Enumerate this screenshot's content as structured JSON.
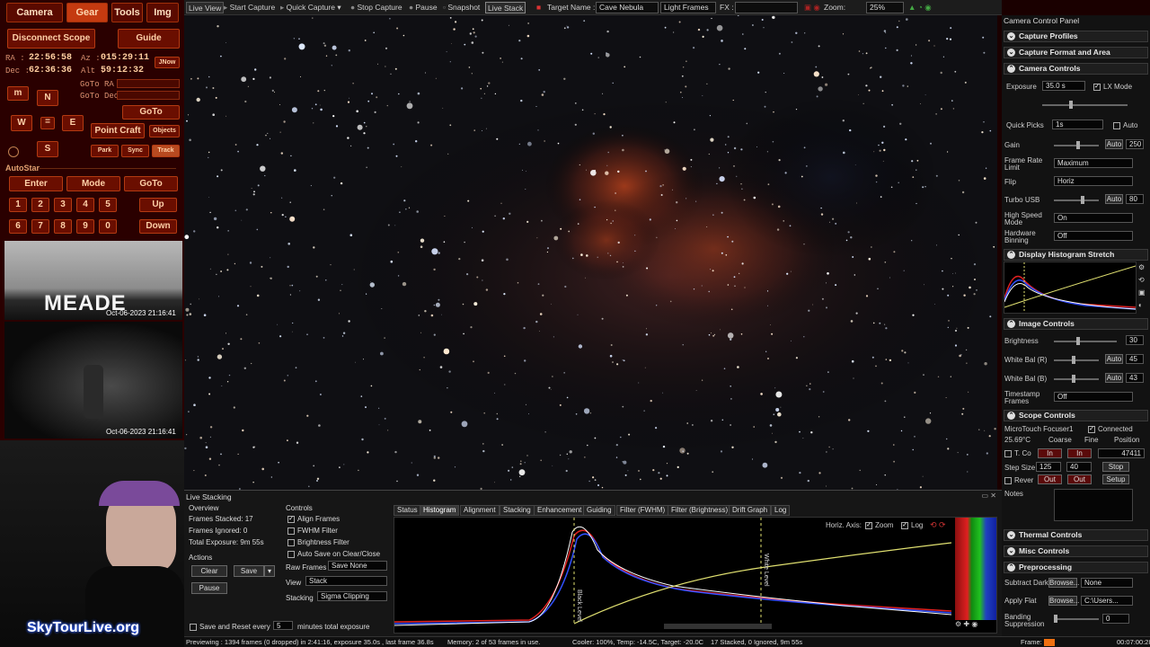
{
  "scope": {
    "tabs": [
      "Camera",
      "Gear",
      "Tools",
      "Img"
    ],
    "disconnect": "Disconnect Scope",
    "guide": "Guide",
    "ra_label": "RA :",
    "ra": "22:56:58",
    "az_label": "Az :",
    "az": "015:29:11",
    "dec_label": "Dec :",
    "dec": "62:36:36",
    "alt_label": "Alt :",
    "alt": "59:12:32",
    "jnow": "JNow",
    "goto_ra": "GoTo RA :",
    "goto_dec": "GoTo Dec:",
    "m": "m",
    "n": "N",
    "w": "W",
    "e": "E",
    "s": "S",
    "goto": "GoTo",
    "point_craft": "Point Craft",
    "objects": "Objects",
    "park": "Park",
    "sync": "Sync",
    "track": "Track",
    "autostar": "AutoStar",
    "enter": "Enter",
    "mode": "Mode",
    "goto2": "GoTo",
    "keys_row1": [
      "1",
      "2",
      "3",
      "4",
      "5"
    ],
    "up": "Up",
    "keys_row2": [
      "6",
      "7",
      "8",
      "9",
      "0"
    ],
    "down": "Down",
    "cam1_brand": "MEADE",
    "cam1_ts": "Oct-06-2023 21:16:41",
    "cam2_ts": "Oct-06-2023 21:16:41",
    "site": "SkyTourLive.org"
  },
  "toolbar": {
    "live_view": "Live View",
    "start_capture": "Start Capture",
    "quick_capture": "Quick Capture",
    "stop_capture": "Stop Capture",
    "pause": "Pause",
    "snapshot": "Snapshot",
    "live_stack": "Live Stack",
    "target_label": "Target Name :",
    "target": "Cave Nebula",
    "frames": "Light Frames",
    "fx": "FX :",
    "zoom_label": "Zoom:",
    "zoom": "25%"
  },
  "panel": {
    "title": "Camera Control Panel",
    "capture_profiles": "Capture Profiles",
    "capture_format": "Capture Format and Area",
    "camera_controls": "Camera Controls",
    "exposure_label": "Exposure",
    "exposure": "35.0 s",
    "lx_mode": "LX Mode",
    "quick_picks": "Quick Picks",
    "quick_val": "1s",
    "auto": "Auto",
    "gain_label": "Gain",
    "gain": "250",
    "frame_rate_label": "Frame Rate Limit",
    "frame_rate": "Maximum",
    "flip_label": "Flip",
    "flip": "Horiz",
    "turbo_label": "Turbo USB",
    "turbo": "80",
    "high_speed_label": "High Speed Mode",
    "high_speed": "On",
    "binning_label": "Hardware Binning",
    "binning": "Off",
    "histogram_stretch": "Display Histogram Stretch",
    "image_controls": "Image Controls",
    "brightness_label": "Brightness",
    "brightness": "30",
    "wbr_label": "White Bal (R)",
    "wbr": "45",
    "wbb_label": "White Bal (B)",
    "wbb": "43",
    "timestamp_label": "Timestamp Frames",
    "timestamp": "Off",
    "scope_controls": "Scope Controls",
    "focuser": "MicroTouch Focuser1",
    "connected": "Connected",
    "temp": "25.69°C",
    "coarse": "Coarse",
    "fine": "Fine",
    "position": "Position",
    "tcomp": "T. Co",
    "in": "In",
    "pos": "47411",
    "step_label": "Step Size",
    "step1": "125",
    "step2": "40",
    "stop": "Stop",
    "reverse": "Rever",
    "out": "Out",
    "setup": "Setup",
    "notes": "Notes",
    "thermal": "Thermal Controls",
    "misc": "Misc Controls",
    "preprocessing": "Preprocessing",
    "dark_label": "Subtract Dark",
    "browse": "Browse...",
    "dark": "None",
    "flat_label": "Apply Flat",
    "flat": "C:\\Users...",
    "banding_label": "Banding Suppression",
    "banding": "0"
  },
  "stack": {
    "title": "Live Stacking",
    "overview": "Overview",
    "stacked": "Frames Stacked: 17",
    "ignored": "Frames Ignored: 0",
    "exposure": "Total Exposure: 9m 55s",
    "actions": "Actions",
    "clear": "Clear",
    "save": "Save",
    "pause": "Pause",
    "controls": "Controls",
    "align": "Align Frames",
    "fwhm": "FWHM Filter",
    "bright": "Brightness Filter",
    "autosave": "Auto Save on Clear/Close",
    "raw_label": "Raw Frames",
    "raw": "Save None",
    "view_label": "View",
    "view": "Stack",
    "stacking_label": "Stacking",
    "stacking": "Sigma Clipping",
    "save_reset": "Save and Reset every",
    "save_reset_val": "5",
    "minutes": "minutes total exposure",
    "tabs": [
      "Status",
      "Histogram",
      "Alignment",
      "Stacking",
      "Enhancement",
      "Guiding",
      "Filter (FWHM)",
      "Filter (Brightness)",
      "Drift Graph",
      "Log"
    ],
    "horiz_axis": "Horiz. Axis:",
    "zoom": "Zoom",
    "log": "Log",
    "black_level": "Black Level",
    "white_level": "White Level"
  },
  "status": {
    "preview": "Previewing : 1394 frames (0 dropped) in 2:41:16, exposure 35.0s , last frame 36.8s",
    "memory": "Memory: 2 of 53 frames in use.",
    "cooler": "Cooler: 100%, Temp: -14.5C, Target: -20.0C",
    "stacked": "17 Stacked, 0 Ignored, 9m 55s",
    "frame": "Frame:",
    "time": "00:07:00:28"
  },
  "colors": {
    "scope_bg": "#2a0000",
    "accent": "#c43a10",
    "nebula": "#a23218",
    "histo_red": "#e02020",
    "histo_blue": "#3050ff",
    "curve": "#e0e070"
  }
}
